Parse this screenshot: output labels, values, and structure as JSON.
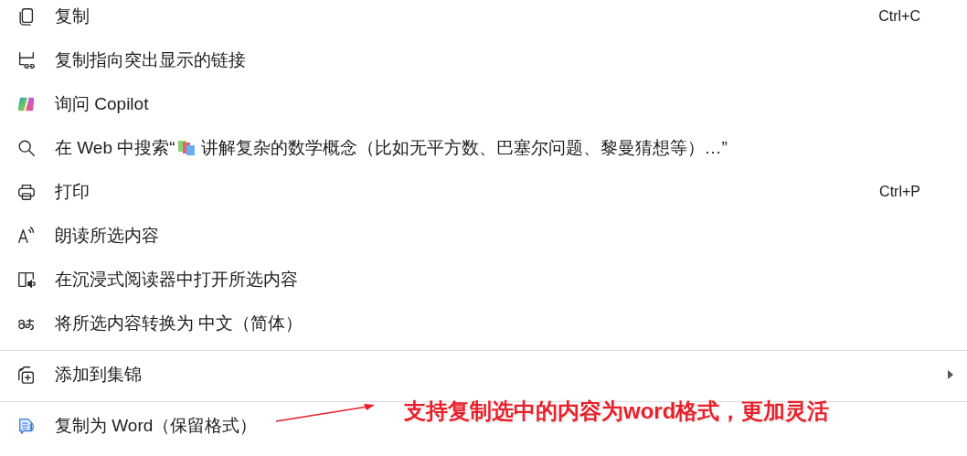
{
  "menu": {
    "items": [
      {
        "kind": "item",
        "label": "复制",
        "shortcut": "Ctrl+C"
      },
      {
        "kind": "item",
        "label": "复制指向突出显示的链接"
      },
      {
        "kind": "item",
        "label": "询问 Copilot"
      },
      {
        "kind": "search",
        "label": "在 Web 中搜索“",
        "query": "讲解复杂的数学概念（比如无平方数、巴塞尔问题、黎曼猜想等）…”"
      },
      {
        "kind": "item",
        "label": "打印",
        "shortcut": "Ctrl+P"
      },
      {
        "kind": "item",
        "label": "朗读所选内容"
      },
      {
        "kind": "item",
        "label": "在沉浸式阅读器中打开所选内容"
      },
      {
        "kind": "item",
        "label": "将所选内容转换为 中文（简体）"
      },
      {
        "kind": "separator"
      },
      {
        "kind": "item",
        "label": "添加到集锦",
        "submenu": true
      },
      {
        "kind": "separator"
      },
      {
        "kind": "item",
        "label": "复制为 Word（保留格式）"
      }
    ]
  },
  "annotation": {
    "text": "支持复制选中的内容为word格式，更加灵活"
  }
}
